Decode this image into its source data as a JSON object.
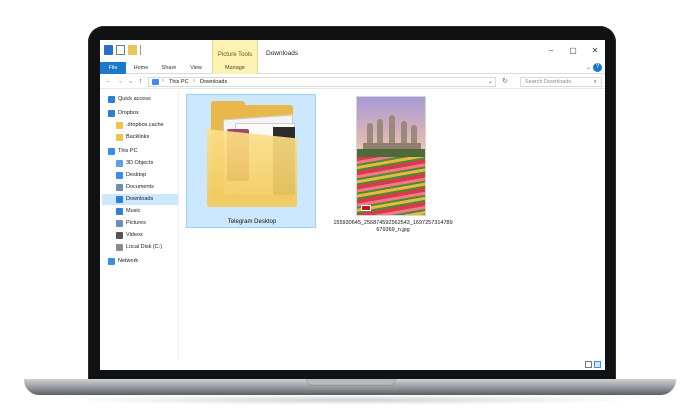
{
  "window": {
    "title": "Downloads",
    "contextual_group": "Picture Tools"
  },
  "ribbon": {
    "tabs": [
      {
        "label": "File"
      },
      {
        "label": "Home"
      },
      {
        "label": "Share"
      },
      {
        "label": "View"
      },
      {
        "label": "Manage"
      }
    ]
  },
  "address": {
    "crumbs": [
      "This PC",
      "Downloads"
    ],
    "search_placeholder": "Search Downloads"
  },
  "sidebar": {
    "items": [
      {
        "label": "Quick access",
        "icon": "star-icon",
        "color": "#2f7fd8"
      },
      {
        "label": "Dropbox",
        "icon": "dropbox-icon",
        "color": "#2f7fd8"
      },
      {
        "label": ".dropbox.cache",
        "icon": "folder-icon",
        "color": "#f0c44a"
      },
      {
        "label": "Backlinks",
        "icon": "folder-icon",
        "color": "#f0c44a"
      },
      {
        "label": "This PC",
        "icon": "computer-icon",
        "color": "#3a8ee6"
      },
      {
        "label": "3D Objects",
        "icon": "cube-icon",
        "color": "#5aa0e8"
      },
      {
        "label": "Desktop",
        "icon": "desktop-icon",
        "color": "#3a8ee6"
      },
      {
        "label": "Documents",
        "icon": "documents-icon",
        "color": "#6b8fb5"
      },
      {
        "label": "Downloads",
        "icon": "download-icon",
        "color": "#2f7fd8"
      },
      {
        "label": "Music",
        "icon": "music-icon",
        "color": "#2f7fd8"
      },
      {
        "label": "Pictures",
        "icon": "pictures-icon",
        "color": "#6b8fb5"
      },
      {
        "label": "Videos",
        "icon": "videos-icon",
        "color": "#555555"
      },
      {
        "label": "Local Disk (C:)",
        "icon": "disk-icon",
        "color": "#8a8a8a"
      },
      {
        "label": "Network",
        "icon": "network-icon",
        "color": "#3a8ee6"
      }
    ],
    "selected": "Downloads"
  },
  "files": [
    {
      "name": "Telegram Desktop",
      "type": "folder"
    },
    {
      "name": "155930645_256874592562543_1697257314789679369_n.jpg",
      "type": "image"
    }
  ],
  "colors": {
    "accent": "#1979ca",
    "selection": "#cce8ff",
    "contextual": "#fbf2b4"
  }
}
